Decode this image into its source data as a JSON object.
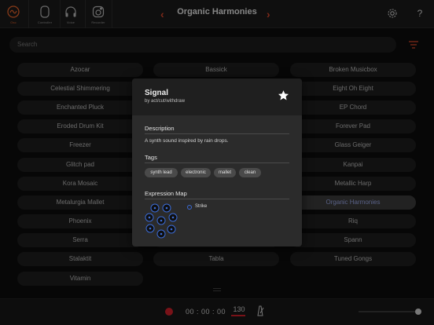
{
  "header": {
    "title": "Organic Harmonies",
    "tabs": [
      {
        "label": "Osc",
        "icon": "oscillator-icon",
        "active": true
      },
      {
        "label": "Controller",
        "icon": "controller-icon",
        "active": false
      },
      {
        "label": "Voice",
        "icon": "headphones-icon",
        "active": false
      },
      {
        "label": "Recorder",
        "icon": "recorder-icon",
        "active": false
      }
    ],
    "prev_icon": "chevron-left-icon",
    "next_icon": "chevron-right-icon",
    "settings_icon": "gear-icon",
    "help_label": "?"
  },
  "search": {
    "placeholder": "Search",
    "filter_icon": "filter-icon"
  },
  "presets": {
    "col1": [
      "Azocar",
      "Celestial Shimmering",
      "Enchanted Pluck",
      "Eroded Drum Kit",
      "Freezer",
      "Glitch pad",
      "Kora Mosaic",
      "Metalurgia Mallet",
      "Phoenix",
      "Serra",
      "Stalaktit",
      "Vitamin"
    ],
    "col2": [
      "Bassick",
      "",
      "",
      "",
      "",
      "",
      "",
      "",
      "",
      "",
      "Tabla"
    ],
    "col3": [
      "Broken Musicbox",
      "Eight Oh Eight",
      "EP Chord",
      "Forever Pad",
      "Glass Geiger",
      "Kanpai",
      "Metallic Harp",
      "Organic Harmonies",
      "Riq",
      "Spann",
      "Tuned Gongs"
    ],
    "selected": "Organic Harmonies"
  },
  "transport": {
    "time": "00 : 00 : 00",
    "bpm": "130",
    "record_color": "#d0202a",
    "metronome_icon": "metronome-icon"
  },
  "modal": {
    "title": "Signal",
    "subtitle": "by act/cut/withdraw",
    "favorite_icon": "star-icon",
    "description_heading": "Description",
    "description": "A synth sound inspired by rain drops.",
    "tags_heading": "Tags",
    "tags": [
      "synth lead",
      "electronic",
      "mallet",
      "clean"
    ],
    "expression_heading": "Expression Map",
    "expression_legend": "Strike",
    "accent": "#3b6bd6"
  }
}
